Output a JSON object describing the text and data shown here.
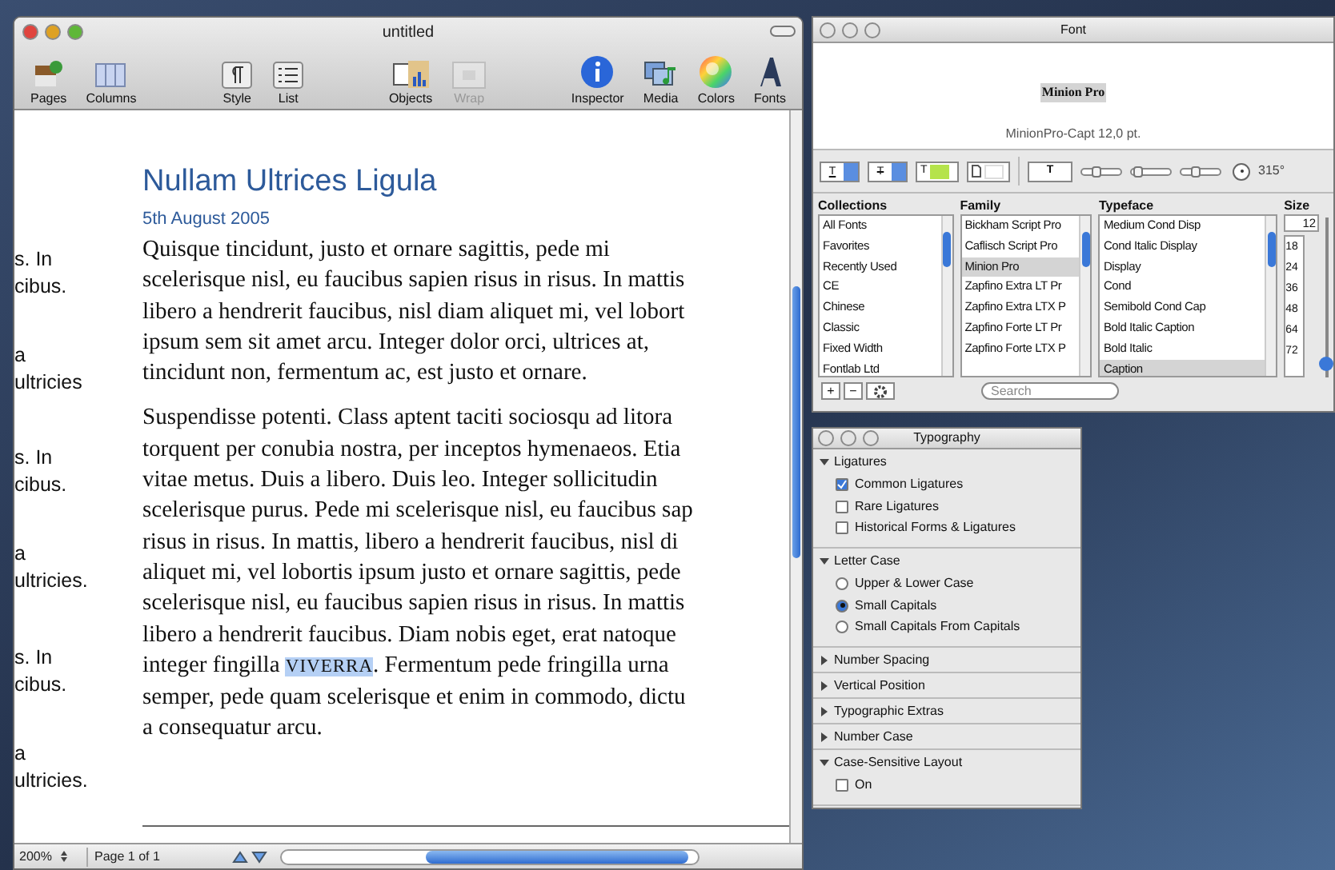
{
  "document_window": {
    "title": "untitled",
    "toolbar_groups": [
      {
        "items": [
          {
            "label": "Pages",
            "disabled": false
          },
          {
            "label": "Columns",
            "disabled": false
          }
        ]
      },
      {
        "items": [
          {
            "label": "Style",
            "disabled": false
          },
          {
            "label": "List",
            "disabled": false
          }
        ]
      },
      {
        "items": [
          {
            "label": "Objects",
            "disabled": false
          },
          {
            "label": "Wrap",
            "disabled": true
          }
        ]
      },
      {
        "items": [
          {
            "label": "Inspector",
            "disabled": false
          },
          {
            "label": "Media",
            "disabled": false
          },
          {
            "label": "Colors",
            "disabled": false
          },
          {
            "label": "Fonts",
            "disabled": false
          }
        ]
      }
    ],
    "side_column": [
      {
        "lines": [
          "s. In",
          "cibus.",
          "a",
          "ultricies"
        ]
      },
      {
        "lines": [
          "s. In",
          "cibus.",
          "a",
          "ultricies."
        ]
      },
      {
        "lines": [
          "s. In",
          "cibus.",
          "a",
          "ultricies."
        ]
      }
    ],
    "heading": "Nullam Ultrices Ligula",
    "date": "5th August 2005",
    "paragraphs": [
      {
        "lines": [
          "Quisque tincidunt, justo et ornare sagittis, pede mi",
          "scelerisque nisl, eu faucibus sapien risus in risus. In mattis",
          "libero a hendrerit faucibus, nisl diam aliquet mi, vel lobort",
          "ipsum sem sit amet arcu. Integer dolor orci, ultrices at,",
          "tincidunt non, fermentum ac, est justo et ornare."
        ]
      },
      {
        "lines": [
          "Suspendisse potenti. Class aptent taciti sociosqu ad litora",
          "torquent per conubia nostra, per inceptos hymenaeos. Etia",
          "vitae metus. Duis a libero. Duis leo. Integer sollicitudin",
          "scelerisque purus. Pede mi scelerisque nisl, eu faucibus sap",
          "risus in risus. In mattis, libero a hendrerit faucibus, nisl di",
          "aliquet mi, vel lobortis ipsum justo et ornare sagittis, pede",
          "scelerisque nisl, eu faucibus sapien risus in risus. In mattis",
          "libero a hendrerit faucibus. Diam nobis eget, erat natoque",
          {
            "before": "integer fingilla ",
            "selection": "VIVERRA",
            "after": ". Fermentum pede fringilla urna"
          },
          "semper, pede quam scelerisque et enim in commodo, dictu",
          "a consequatur arcu."
        ]
      }
    ],
    "status_bar": {
      "zoom": "200%",
      "page": "Page 1 of 1"
    }
  },
  "font_panel": {
    "title": "Font",
    "preview": "Minion Pro",
    "font_info": "MinionPro-Capt 12,0 pt.",
    "style_buttons": [
      "T",
      "T",
      "T",
      "T"
    ],
    "shadow_sliders": [
      {
        "level": 0.3
      },
      {
        "level": 0.05
      },
      {
        "level": 0.3
      }
    ],
    "angle": "315°",
    "columns": [
      {
        "header": "Collections",
        "items": [
          {
            "label": "All Fonts",
            "selected": false
          },
          {
            "label": "Favorites",
            "selected": false
          },
          {
            "label": "Recently Used",
            "selected": false
          },
          {
            "label": "CE",
            "selected": false
          },
          {
            "label": "Chinese",
            "selected": false
          },
          {
            "label": "Classic",
            "selected": false
          },
          {
            "label": "Fixed Width",
            "selected": false
          },
          {
            "label": "Fontlab Ltd",
            "selected": false
          }
        ]
      },
      {
        "header": "Family",
        "items": [
          {
            "label": "Bickham Script Pro",
            "selected": false
          },
          {
            "label": "Caflisch Script Pro",
            "selected": false
          },
          {
            "label": "Minion Pro",
            "selected": true
          },
          {
            "label": "Zapfino Extra LT Pr",
            "selected": false
          },
          {
            "label": "Zapfino Extra LTX P",
            "selected": false
          },
          {
            "label": "Zapfino Forte LT Pr",
            "selected": false
          },
          {
            "label": "Zapfino Forte LTX P",
            "selected": false
          }
        ]
      },
      {
        "header": "Typeface",
        "items": [
          {
            "label": "Medium Cond Disp",
            "selected": false
          },
          {
            "label": "Cond Italic Display",
            "selected": false
          },
          {
            "label": "Display",
            "selected": false
          },
          {
            "label": "Cond",
            "selected": false
          },
          {
            "label": "Semibold Cond Cap",
            "selected": false
          },
          {
            "label": "Bold Italic Caption",
            "selected": false
          },
          {
            "label": "Bold Italic",
            "selected": false
          },
          {
            "label": "Caption",
            "selected": true
          }
        ]
      }
    ],
    "size": {
      "header": "Size",
      "value": "12",
      "items": [
        "18",
        "24",
        "36",
        "48",
        "64",
        "72"
      ],
      "level": 0.05
    },
    "buttons": [
      "+",
      "−"
    ],
    "search": {
      "placeholder": "Search"
    }
  },
  "typography_panel": {
    "title": "Typography",
    "sections": [
      {
        "title": "Ligatures",
        "expanded": true,
        "options": [
          {
            "kind": "checkbox",
            "label": "Common Ligatures",
            "checked": true
          },
          {
            "kind": "checkbox",
            "label": "Rare Ligatures",
            "checked": false
          },
          {
            "kind": "checkbox",
            "label": "Historical Forms & Ligatures",
            "checked": false
          }
        ]
      },
      {
        "title": "Letter Case",
        "expanded": true,
        "options": [
          {
            "kind": "radio",
            "label": "Upper & Lower Case",
            "selected": false
          },
          {
            "kind": "radio",
            "label": "Small Capitals",
            "selected": true
          },
          {
            "kind": "radio",
            "label": "Small Capitals From Capitals",
            "selected": false
          }
        ]
      },
      {
        "title": "Number Spacing",
        "expanded": false
      },
      {
        "title": "Vertical Position",
        "expanded": false
      },
      {
        "title": "Typographic Extras",
        "expanded": false
      },
      {
        "title": "Number Case",
        "expanded": false
      },
      {
        "title": "Case-Sensitive Layout",
        "expanded": true,
        "options": [
          {
            "kind": "checkbox",
            "label": "On",
            "checked": false
          }
        ]
      }
    ]
  }
}
